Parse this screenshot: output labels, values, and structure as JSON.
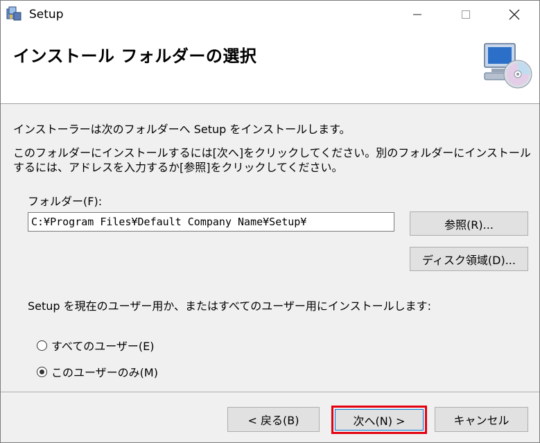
{
  "window": {
    "title": "Setup",
    "controls": {
      "minimize": "—",
      "maximize": "☐",
      "close": "✕"
    }
  },
  "banner": {
    "title": "インストール フォルダーの選択",
    "icon": "computer-cd-icon"
  },
  "body": {
    "intro1": "インストーラーは次のフォルダーへ Setup をインストールします。",
    "intro2": "このフォルダーにインストールするには[次へ]をクリックしてください。別のフォルダーにインストールするには、アドレスを入力するか[参照]をクリックしてください。",
    "folder_label": "フォルダー(F):",
    "folder_value": "C:¥Program Files¥Default Company Name¥Setup¥",
    "browse_label": "参照(R)...",
    "disk_label": "ディスク領域(D)...",
    "install_for_text": "Setup を現在のユーザー用か、またはすべてのユーザー用にインストールします:",
    "radio_all_label": "すべてのユーザー(E)",
    "radio_me_label": "このユーザーのみ(M)",
    "selected_option": "このユーザーのみ(M)"
  },
  "footer": {
    "back_label": "< 戻る(B)",
    "next_label": "次へ(N) >",
    "cancel_label": "キャンセル"
  },
  "colors": {
    "highlight": "#e3000f",
    "button_bg": "#e1e1e1",
    "dialog_bg": "#f0f0f0"
  }
}
